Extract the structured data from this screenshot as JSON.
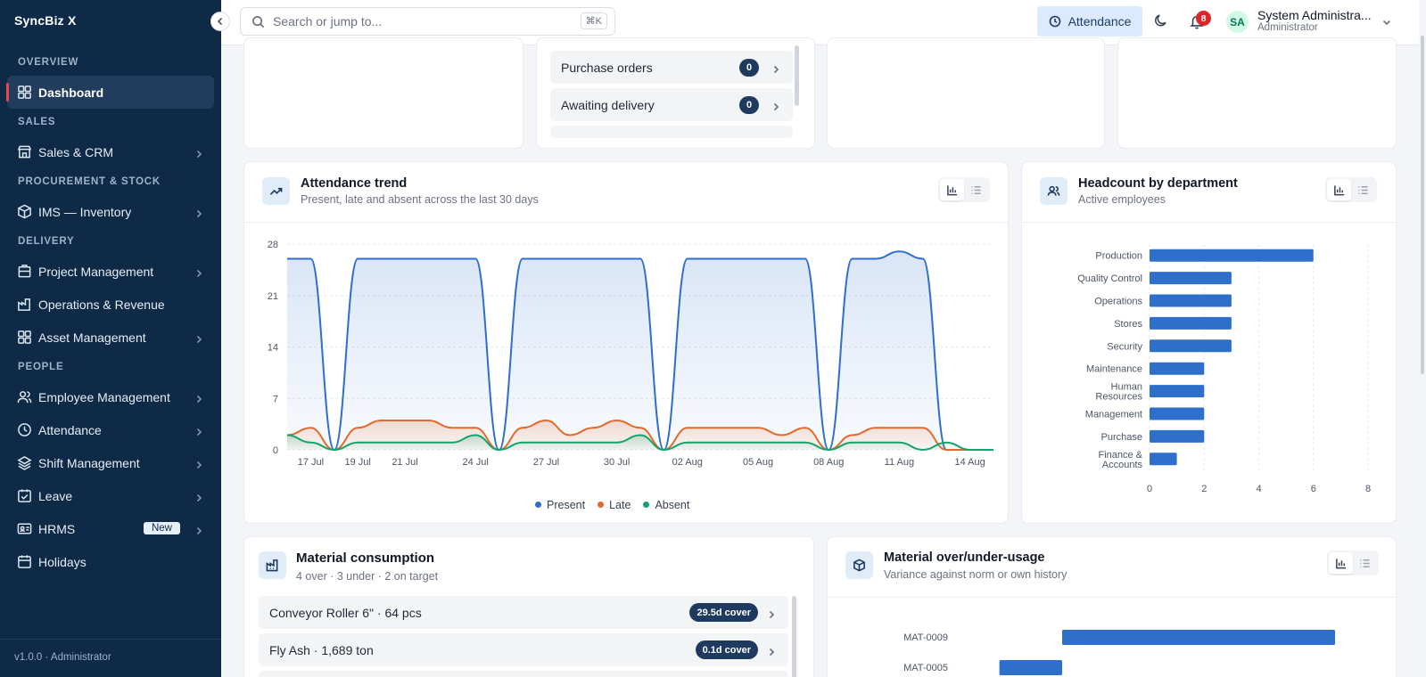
{
  "app": {
    "brand": "SyncBiz X",
    "version_label": "v1.0.0 · Administrator"
  },
  "sidebar": {
    "sections": [
      {
        "title": "OVERVIEW",
        "items": [
          {
            "label": "Dashboard",
            "icon": "grid-icon",
            "active": true
          }
        ]
      },
      {
        "title": "SALES",
        "items": [
          {
            "label": "Sales & CRM",
            "icon": "store-icon",
            "chevron": true
          }
        ]
      },
      {
        "title": "PROCUREMENT & STOCK",
        "items": [
          {
            "label": "IMS — Inventory",
            "icon": "box-icon",
            "chevron": true
          }
        ]
      },
      {
        "title": "DELIVERY",
        "items": [
          {
            "label": "Project Management",
            "icon": "building-icon",
            "chevron": true
          },
          {
            "label": "Operations & Revenue",
            "icon": "factory-icon"
          },
          {
            "label": "Asset Management",
            "icon": "grid-icon",
            "chevron": true
          }
        ]
      },
      {
        "title": "PEOPLE",
        "items": [
          {
            "label": "Employee Management",
            "icon": "users-icon",
            "chevron": true
          },
          {
            "label": "Attendance",
            "icon": "clock-icon",
            "chevron": true
          },
          {
            "label": "Shift Management",
            "icon": "layers-icon",
            "chevron": true
          },
          {
            "label": "Leave",
            "icon": "calendar-check-icon",
            "chevron": true
          },
          {
            "label": "HRMS",
            "icon": "id-card-icon",
            "chevron": true,
            "badge": "New"
          },
          {
            "label": "Holidays",
            "icon": "calendar-icon"
          }
        ]
      }
    ]
  },
  "topbar": {
    "search_placeholder": "Search or jump to...",
    "search_shortcut": "⌘K",
    "attendance_button": "Attendance",
    "notification_count": "8",
    "user_initials": "SA",
    "user_name": "System Administra...",
    "user_role": "Administrator"
  },
  "procurement_list": {
    "rows": [
      {
        "label": "Purchase orders",
        "count": "0"
      },
      {
        "label": "Awaiting delivery",
        "count": "0"
      }
    ]
  },
  "attendance_trend": {
    "title": "Attendance trend",
    "subtitle": "Present, late and absent across the last 30 days",
    "chart_data": {
      "type": "area",
      "x": [
        "16 Jul",
        "17 Jul",
        "18 Jul",
        "19 Jul",
        "20 Jul",
        "21 Jul",
        "22 Jul",
        "23 Jul",
        "24 Jul",
        "25 Jul",
        "26 Jul",
        "27 Jul",
        "28 Jul",
        "29 Jul",
        "30 Jul",
        "31 Jul",
        "01 Aug",
        "02 Aug",
        "03 Aug",
        "04 Aug",
        "05 Aug",
        "06 Aug",
        "07 Aug",
        "08 Aug",
        "09 Aug",
        "10 Aug",
        "11 Aug",
        "12 Aug",
        "13 Aug",
        "14 Aug",
        "15 Aug"
      ],
      "x_tick_labels": [
        "17 Jul",
        "19 Jul",
        "21 Jul",
        "24 Jul",
        "27 Jul",
        "30 Jul",
        "02 Aug",
        "05 Aug",
        "08 Aug",
        "11 Aug",
        "14 Aug"
      ],
      "y_ticks": [
        0,
        7,
        14,
        21,
        28
      ],
      "ylim": [
        0,
        28
      ],
      "series": [
        {
          "name": "Present",
          "color": "#2e6fcb",
          "values": [
            26,
            26,
            0,
            26,
            26,
            26,
            26,
            26,
            26,
            0,
            26,
            26,
            26,
            26,
            26,
            26,
            0,
            26,
            26,
            26,
            26,
            26,
            26,
            0,
            26,
            26,
            27,
            26,
            0,
            0,
            0
          ]
        },
        {
          "name": "Late",
          "color": "#e06a2b",
          "values": [
            2,
            3,
            0,
            3,
            4,
            4,
            4,
            3,
            3,
            0,
            3,
            4,
            2,
            3,
            4,
            3,
            0,
            3,
            3,
            3,
            3,
            2,
            3,
            0,
            2,
            3,
            3,
            3,
            0,
            0,
            0
          ]
        },
        {
          "name": "Absent",
          "color": "#16a36b",
          "values": [
            2,
            1,
            0,
            1,
            1,
            1,
            1,
            1,
            2,
            0,
            1,
            1,
            1,
            1,
            1,
            2,
            0,
            1,
            1,
            1,
            1,
            1,
            1,
            0,
            1,
            1,
            1,
            0,
            1,
            0,
            0
          ]
        }
      ],
      "grid": true,
      "legend": "bottom"
    }
  },
  "headcount": {
    "title": "Headcount by department",
    "subtitle": "Active employees",
    "chart_data": {
      "type": "bar",
      "orientation": "horizontal",
      "categories": [
        "Production",
        "Quality Control",
        "Operations",
        "Stores",
        "Security",
        "Maintenance",
        "Human Resources",
        "Management",
        "Purchase",
        "Finance & Accounts"
      ],
      "category_lines": [
        [
          "Production"
        ],
        [
          "Quality Control"
        ],
        [
          "Operations"
        ],
        [
          "Stores"
        ],
        [
          "Security"
        ],
        [
          "Maintenance"
        ],
        [
          "Human",
          "Resources"
        ],
        [
          "Management"
        ],
        [
          "Purchase"
        ],
        [
          "Finance &",
          "Accounts"
        ]
      ],
      "values": [
        6,
        3,
        3,
        3,
        3,
        2,
        2,
        2,
        2,
        1
      ],
      "x_ticks": [
        0,
        2,
        4,
        6,
        8
      ],
      "xlim": [
        0,
        8
      ],
      "color": "#2e6fcb"
    }
  },
  "material_consumption": {
    "title": "Material consumption",
    "subtitle": "4 over · 3 under · 2 on target",
    "rows": [
      {
        "label": "Conveyor Roller 6\" · 64 pcs",
        "cover": "29.5d cover"
      },
      {
        "label": "Fly Ash · 1,689 ton",
        "cover": "0.1d cover"
      }
    ]
  },
  "material_usage": {
    "title": "Material over/under-usage",
    "subtitle": "Variance against norm or own history",
    "chart_data": {
      "type": "bar",
      "orientation": "horizontal",
      "categories": [
        "MAT-0009",
        "MAT-0005"
      ],
      "values": [
        100,
        -23
      ],
      "color": "#2e6fcb"
    }
  }
}
